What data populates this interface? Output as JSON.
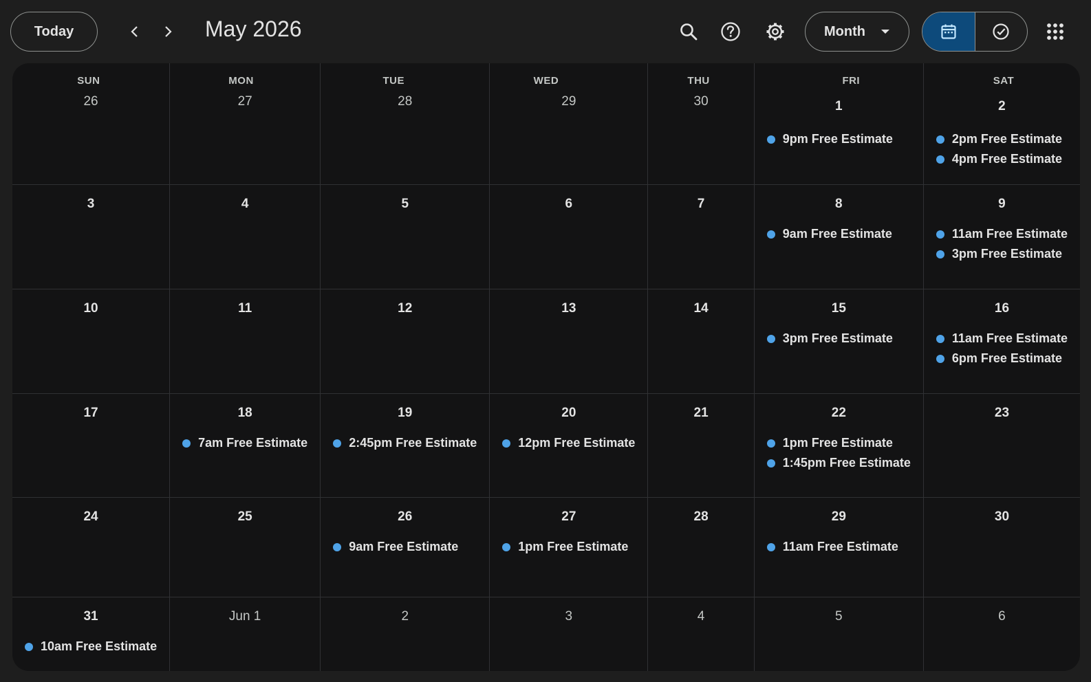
{
  "toolbar": {
    "today_label": "Today",
    "prev_icon": "chevron-left-icon",
    "next_icon": "chevron-right-icon",
    "title": "May 2026",
    "view_label": "Month",
    "search_icon": "search-icon",
    "help_icon": "help-icon",
    "settings_icon": "gear-icon",
    "calendar_icon": "calendar-icon",
    "tasks_icon": "check-circle-icon",
    "apps_icon": "apps-grid-icon"
  },
  "colors": {
    "accent": "#4fa3e8",
    "active_segment": "#0d4a7b",
    "background": "#1e1e1e",
    "grid_background": "#131314"
  },
  "weekdays": [
    "SUN",
    "MON",
    "TUE",
    "WED",
    "THU",
    "FRI",
    "SAT"
  ],
  "weeks": [
    [
      {
        "day": "26",
        "muted": true,
        "events": []
      },
      {
        "day": "27",
        "muted": true,
        "events": []
      },
      {
        "day": "28",
        "muted": true,
        "events": []
      },
      {
        "day": "29",
        "muted": true,
        "events": []
      },
      {
        "day": "30",
        "muted": true,
        "events": []
      },
      {
        "day": "1",
        "muted": false,
        "events": [
          "9pm Free Estimate"
        ]
      },
      {
        "day": "2",
        "muted": false,
        "events": [
          "2pm Free Estimate",
          "4pm Free Estimate"
        ]
      }
    ],
    [
      {
        "day": "3",
        "muted": false,
        "events": []
      },
      {
        "day": "4",
        "muted": false,
        "events": []
      },
      {
        "day": "5",
        "muted": false,
        "events": []
      },
      {
        "day": "6",
        "muted": false,
        "events": []
      },
      {
        "day": "7",
        "muted": false,
        "events": []
      },
      {
        "day": "8",
        "muted": false,
        "events": [
          "9am Free Estimate"
        ]
      },
      {
        "day": "9",
        "muted": false,
        "events": [
          "11am Free Estimate",
          "3pm Free Estimate"
        ]
      }
    ],
    [
      {
        "day": "10",
        "muted": false,
        "events": []
      },
      {
        "day": "11",
        "muted": false,
        "events": []
      },
      {
        "day": "12",
        "muted": false,
        "events": []
      },
      {
        "day": "13",
        "muted": false,
        "events": []
      },
      {
        "day": "14",
        "muted": false,
        "events": []
      },
      {
        "day": "15",
        "muted": false,
        "events": [
          "3pm Free Estimate"
        ]
      },
      {
        "day": "16",
        "muted": false,
        "events": [
          "11am Free Estimate",
          "6pm Free Estimate"
        ]
      }
    ],
    [
      {
        "day": "17",
        "muted": false,
        "events": []
      },
      {
        "day": "18",
        "muted": false,
        "events": [
          "7am Free Estimate"
        ]
      },
      {
        "day": "19",
        "muted": false,
        "events": [
          "2:45pm Free Estimate"
        ]
      },
      {
        "day": "20",
        "muted": false,
        "events": [
          "12pm Free Estimate"
        ]
      },
      {
        "day": "21",
        "muted": false,
        "events": []
      },
      {
        "day": "22",
        "muted": false,
        "events": [
          "1pm Free Estimate",
          "1:45pm Free Estimate"
        ]
      },
      {
        "day": "23",
        "muted": false,
        "events": []
      }
    ],
    [
      {
        "day": "24",
        "muted": false,
        "events": []
      },
      {
        "day": "25",
        "muted": false,
        "events": []
      },
      {
        "day": "26",
        "muted": false,
        "events": [
          "9am Free Estimate"
        ]
      },
      {
        "day": "27",
        "muted": false,
        "events": [
          "1pm Free Estimate"
        ]
      },
      {
        "day": "28",
        "muted": false,
        "events": []
      },
      {
        "day": "29",
        "muted": false,
        "events": [
          "11am Free Estimate"
        ]
      },
      {
        "day": "30",
        "muted": false,
        "events": []
      }
    ],
    [
      {
        "day": "31",
        "muted": false,
        "events": [
          "10am Free Estimate"
        ]
      },
      {
        "day": "Jun 1",
        "muted": true,
        "events": []
      },
      {
        "day": "2",
        "muted": true,
        "events": []
      },
      {
        "day": "3",
        "muted": true,
        "events": []
      },
      {
        "day": "4",
        "muted": true,
        "events": []
      },
      {
        "day": "5",
        "muted": true,
        "events": []
      },
      {
        "day": "6",
        "muted": true,
        "events": []
      }
    ]
  ]
}
